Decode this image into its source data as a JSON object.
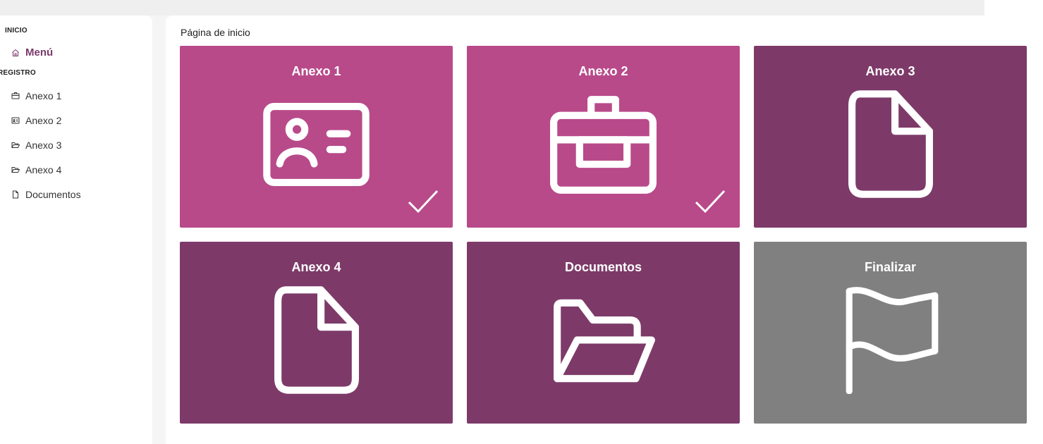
{
  "sidebar": {
    "section_inicio": "INICIO",
    "menu_label": "Menú",
    "section_registro": "REGISTRO",
    "items": [
      {
        "label": "Anexo 1",
        "icon": "id-card-icon"
      },
      {
        "label": "Anexo 2",
        "icon": "briefcase-icon"
      },
      {
        "label": "Anexo 3",
        "icon": "folder-open-icon"
      },
      {
        "label": "Anexo 4",
        "icon": "folder-open-icon"
      },
      {
        "label": "Documentos",
        "icon": "document-icon"
      }
    ]
  },
  "main": {
    "page_title": "Página de inicio",
    "tiles": [
      {
        "title": "Anexo 1",
        "icon": "id-card-icon",
        "completed": true,
        "color": "#b84a8a"
      },
      {
        "title": "Anexo 2",
        "icon": "briefcase-icon",
        "completed": true,
        "color": "#b84a8a"
      },
      {
        "title": "Anexo 3",
        "icon": "document-icon",
        "completed": false,
        "color": "#7d3a69"
      },
      {
        "title": "Anexo 4",
        "icon": "document-icon",
        "completed": false,
        "color": "#7d3a69"
      },
      {
        "title": "Documentos",
        "icon": "folder-open-icon",
        "completed": false,
        "color": "#7d3a69"
      },
      {
        "title": "Finalizar",
        "icon": "flag-icon",
        "completed": false,
        "color": "#808080"
      }
    ]
  },
  "colors": {
    "accent": "#7a3a6b",
    "tile_done": "#b84a8a",
    "tile_pending": "#7d3a69",
    "tile_finish": "#808080"
  }
}
